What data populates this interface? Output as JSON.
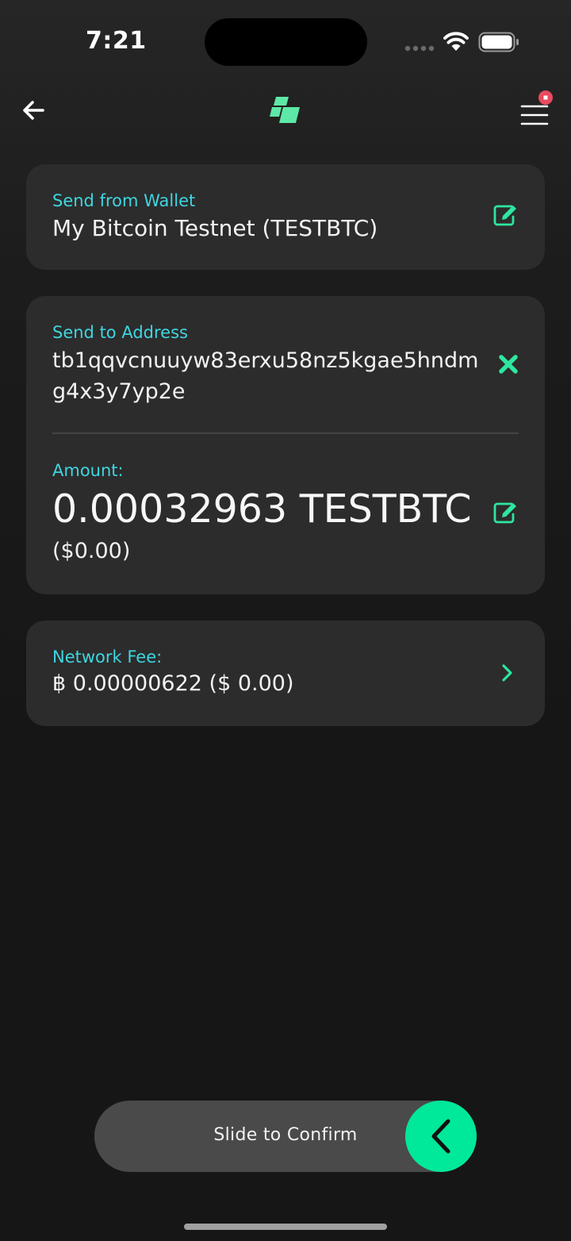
{
  "status_bar": {
    "time": "7:21"
  },
  "nav": {
    "back_icon": "arrow-left-icon",
    "logo_icon": "app-logo-icon",
    "menu_icon": "hamburger-menu-icon",
    "notification_color": "#e84a5f"
  },
  "wallet_card": {
    "label": "Send from Wallet",
    "value": "My Bitcoin Testnet (TESTBTC)",
    "edit_icon": "edit-icon"
  },
  "address_card": {
    "address_label": "Send to Address",
    "address_value": "tb1qqvcnuuyw83erxu58nz5kgae5hndmg4x3y7yp2e",
    "clear_icon": "close-x-icon",
    "amount_label": "Amount:",
    "amount_value": "0.00032963 TESTBTC",
    "amount_fiat": "($0.00)",
    "edit_icon": "edit-icon"
  },
  "fee_card": {
    "label": "Network Fee:",
    "value": "฿ 0.00000622 ($ 0.00)",
    "chevron_icon": "chevron-right-icon"
  },
  "slider": {
    "label": "Slide to Confirm",
    "handle_icon": "chevron-left-icon"
  },
  "colors": {
    "accent_green": "#00e89a",
    "label_cyan": "#3ed6e0",
    "card_background": "#2c2c2c"
  }
}
